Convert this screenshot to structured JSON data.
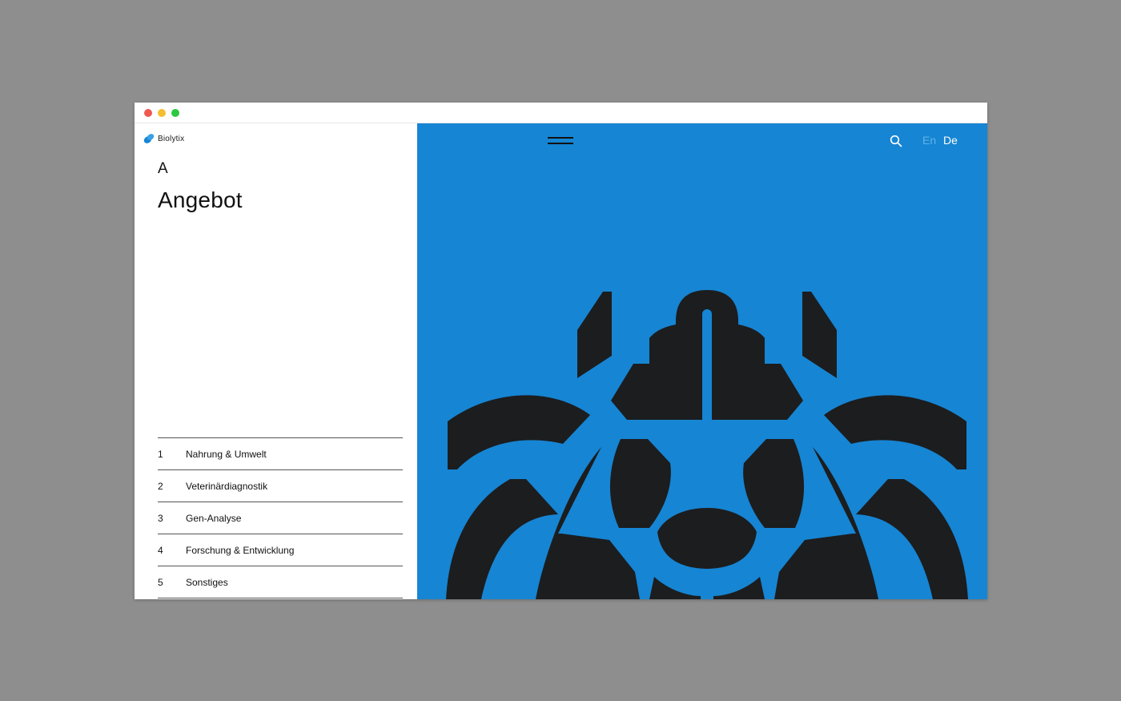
{
  "brand": {
    "name": "Biolytix",
    "logo_icon": "biolytix-logo-icon"
  },
  "section": {
    "letter": "A",
    "title": "Angebot"
  },
  "menu": {
    "items": [
      {
        "num": "1",
        "label": "Nahrung & Umwelt"
      },
      {
        "num": "2",
        "label": "Veterinärdiagnostik"
      },
      {
        "num": "3",
        "label": "Gen-Analyse"
      },
      {
        "num": "4",
        "label": "Forschung & Entwicklung"
      },
      {
        "num": "5",
        "label": "Sonstiges"
      }
    ]
  },
  "header": {
    "menu_icon": "hamburger-menu-icon",
    "search_icon": "search-icon",
    "languages": [
      {
        "code": "En",
        "active": false
      },
      {
        "code": "De",
        "active": true
      }
    ]
  },
  "illustration": {
    "name": "beetle-emblem",
    "colors": {
      "background": "#1685d3",
      "figure": "#1c1d1f"
    }
  },
  "window": {
    "controls": [
      "close",
      "minimize",
      "maximize"
    ]
  }
}
